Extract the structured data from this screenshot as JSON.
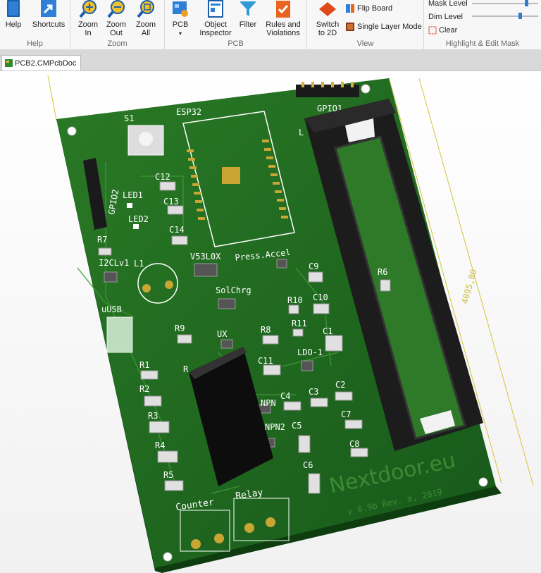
{
  "ribbon": {
    "help_group": {
      "help": "Help",
      "shortcuts": "Shortcuts",
      "label": "Help"
    },
    "zoom_group": {
      "zoom_in": "Zoom\nIn",
      "zoom_out": "Zoom\nOut",
      "zoom_all": "Zoom\nAll",
      "label": "Zoom"
    },
    "pcb_group": {
      "pcb": "PCB",
      "object_inspector": "Object\nInspector",
      "filter": "Filter",
      "rules": "Rules and\nViolations",
      "label": "PCB"
    },
    "view_group": {
      "switch_2d": "Switch\nto 2D",
      "flip_board": "Flip Board",
      "single_layer": "Single Layer Mode",
      "label": "View"
    },
    "mask_group": {
      "mask_level": "Mask Level",
      "mask_level_value": 0.82,
      "dim_level": "Dim Level",
      "dim_level_value": 0.72,
      "clear": "Clear",
      "label": "Highlight & Edit Mask"
    }
  },
  "document_tab": {
    "label": "PCB2.CMPcbDoc"
  },
  "board": {
    "header": "GPIO1",
    "l_label": "L",
    "s1": "S1",
    "esp32": "ESP32",
    "gpio2": "GPIO2",
    "c12": "C12",
    "c13": "C13",
    "c14": "C14",
    "led1": "LED1",
    "led2": "LED2",
    "r7": "R7",
    "i2clv1": "I2CLv1",
    "l1": "L1",
    "v53l0x": "V53L0X",
    "press_accel": "Press.Accel",
    "c9": "C9",
    "r6": "R6",
    "solchrg": "SolChrg",
    "r10": "R10",
    "c10": "C10",
    "usb": "uUSB",
    "r9": "R9",
    "ux": "UX",
    "r8": "R8",
    "r11": "R11",
    "c1": "C1",
    "ldo1": "LDO-1",
    "r1": "R1",
    "r_small": "R",
    "c11": "C11",
    "r2": "R2",
    "c4": "C4",
    "c3": "C3",
    "c2": "C2",
    "npn": "NPN",
    "r3": "R3",
    "npn2": "NPN2",
    "c5": "C5",
    "c7": "C7",
    "r4": "R4",
    "c8": "C8",
    "r5": "R5",
    "c6": "C6",
    "counter": "Counter",
    "relay": "Relay",
    "brand": "Nextdoor.eu",
    "version": "v 0.9b Rev. a, 2019",
    "dimension": "4095,00"
  },
  "colors": {
    "board": "#1f6b1d",
    "silk": "#ffffff",
    "accent": "#2a7fd4"
  }
}
